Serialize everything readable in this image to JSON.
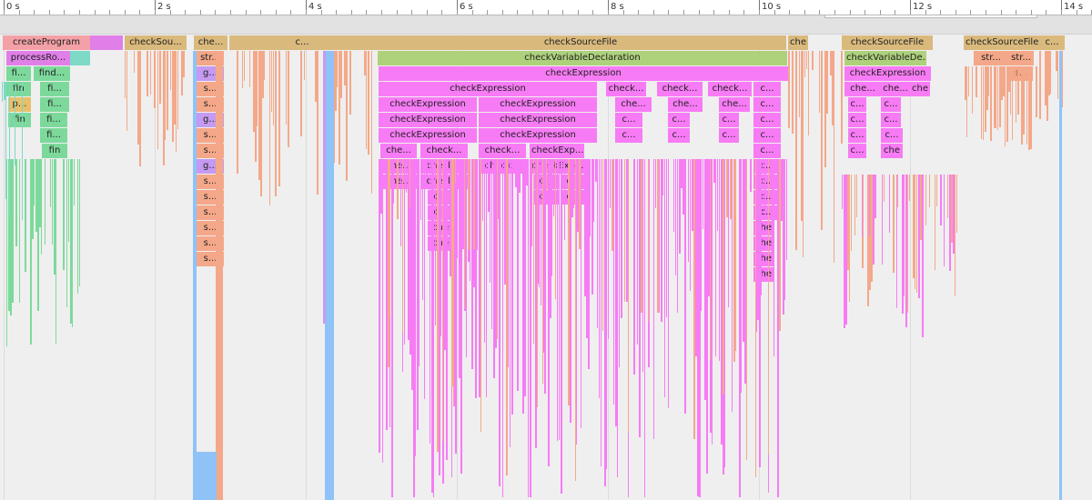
{
  "ruler": {
    "labels": [
      "0 s",
      "2 s",
      "4 s",
      "6 s",
      "8 s",
      "10 s",
      "12 s",
      "14 s"
    ]
  },
  "colors": {
    "program": "#f3a0a6",
    "root": "#e17fe8",
    "host": "#7ed9c7",
    "find": "#7dd99b",
    "check": "#d9b97c",
    "variable": "#aed17c",
    "expression": "#f77bf5",
    "string": "#f4a889",
    "get": "#c59af2",
    "gc": "#8fc3f7",
    "type": "#e8c06c"
  },
  "frames": [
    {
      "label": "createProgram",
      "color": "program"
    },
    {
      "label": "",
      "color": "root"
    },
    {
      "label": "checkSou...",
      "color": "check"
    },
    {
      "label": "che...",
      "color": "check"
    },
    {
      "label": "c...",
      "color": "check"
    },
    {
      "label": "checkSourceFile",
      "color": "check"
    },
    {
      "label": "che",
      "color": "check"
    },
    {
      "label": "checkSourceFile",
      "color": "check"
    },
    {
      "label": "checkSourceFile",
      "color": "check"
    },
    {
      "label": "c...",
      "color": "check"
    },
    {
      "label": "processRo...",
      "color": "root"
    },
    {
      "label": "",
      "color": "host"
    },
    {
      "label": "str...",
      "color": "string"
    },
    {
      "label": "checkVariableDeclaration",
      "color": "variable"
    },
    {
      "label": "checkVariableDe...",
      "color": "variable"
    },
    {
      "label": "str...",
      "color": "string"
    },
    {
      "label": "str...",
      "color": "string"
    },
    {
      "label": "fi...",
      "color": "find"
    },
    {
      "label": "find...",
      "color": "find"
    },
    {
      "label": "g...",
      "color": "get"
    },
    {
      "label": "checkExpression",
      "color": "expression"
    },
    {
      "label": "checkExpression",
      "color": "expression"
    },
    {
      "label": "s...",
      "color": "string"
    },
    {
      "label": "fin",
      "color": "find"
    },
    {
      "label": "fi...",
      "color": "find"
    },
    {
      "label": "s...",
      "color": "string"
    },
    {
      "label": "checkExpression",
      "color": "expression"
    },
    {
      "label": "check...",
      "color": "expression"
    },
    {
      "label": "check...",
      "color": "expression"
    },
    {
      "label": "check...",
      "color": "expression"
    },
    {
      "label": "c...",
      "color": "expression"
    },
    {
      "label": "che...",
      "color": "expression"
    },
    {
      "label": "che...",
      "color": "expression"
    },
    {
      "label": "che",
      "color": "expression"
    },
    {
      "label": "p...",
      "color": "type"
    },
    {
      "label": "fi...",
      "color": "find"
    },
    {
      "label": "s...",
      "color": "string"
    },
    {
      "label": "checkExpression",
      "color": "expression"
    },
    {
      "label": "checkExpression",
      "color": "expression"
    },
    {
      "label": "che...",
      "color": "expression"
    },
    {
      "label": "che...",
      "color": "expression"
    },
    {
      "label": "che...",
      "color": "expression"
    },
    {
      "label": "c...",
      "color": "expression"
    },
    {
      "label": "c...",
      "color": "expression"
    },
    {
      "label": "c...",
      "color": "expression"
    },
    {
      "label": "fin",
      "color": "find"
    },
    {
      "label": "fi...",
      "color": "find"
    },
    {
      "label": "g...",
      "color": "get"
    },
    {
      "label": "checkExpression",
      "color": "expression"
    },
    {
      "label": "checkExpression",
      "color": "expression"
    },
    {
      "label": "c...",
      "color": "expression"
    },
    {
      "label": "c...",
      "color": "expression"
    },
    {
      "label": "c...",
      "color": "expression"
    },
    {
      "label": "c...",
      "color": "expression"
    },
    {
      "label": "c...",
      "color": "expression"
    },
    {
      "label": "c...",
      "color": "expression"
    },
    {
      "label": "fi...",
      "color": "find"
    },
    {
      "label": "s...",
      "color": "string"
    },
    {
      "label": "checkExpression",
      "color": "expression"
    },
    {
      "label": "checkExpression",
      "color": "expression"
    },
    {
      "label": "c...",
      "color": "expression"
    },
    {
      "label": "c...",
      "color": "expression"
    },
    {
      "label": "c...",
      "color": "expression"
    },
    {
      "label": "c...",
      "color": "expression"
    },
    {
      "label": "c...",
      "color": "expression"
    },
    {
      "label": "c...",
      "color": "expression"
    },
    {
      "label": "fin",
      "color": "find"
    },
    {
      "label": "s...",
      "color": "string"
    },
    {
      "label": "che...",
      "color": "expression"
    },
    {
      "label": "check...",
      "color": "expression"
    },
    {
      "label": "check...",
      "color": "expression"
    },
    {
      "label": "checkExp...",
      "color": "expression"
    },
    {
      "label": "c...",
      "color": "expression"
    },
    {
      "label": "c...",
      "color": "expression"
    },
    {
      "label": "che",
      "color": "expression"
    },
    {
      "label": "g...",
      "color": "get"
    },
    {
      "label": "che...",
      "color": "expression"
    },
    {
      "label": "check...",
      "color": "expression"
    },
    {
      "label": "check...",
      "color": "expression"
    },
    {
      "label": "checkExp...",
      "color": "expression"
    },
    {
      "label": "c...",
      "color": "expression"
    },
    {
      "label": "s...",
      "color": "string"
    },
    {
      "label": "che...",
      "color": "expression"
    },
    {
      "label": "check...",
      "color": "expression"
    },
    {
      "label": "c...",
      "color": "expression"
    },
    {
      "label": "c...",
      "color": "expression"
    },
    {
      "label": "c...",
      "color": "expression"
    },
    {
      "label": "s...",
      "color": "string"
    },
    {
      "label": "c...",
      "color": "expression"
    },
    {
      "label": "c...",
      "color": "expression"
    },
    {
      "label": "c...",
      "color": "expression"
    },
    {
      "label": "c...",
      "color": "expression"
    },
    {
      "label": "s...",
      "color": "string"
    },
    {
      "label": "c...",
      "color": "expression"
    },
    {
      "label": "c...",
      "color": "expression"
    },
    {
      "label": "s...",
      "color": "string"
    },
    {
      "label": "che",
      "color": "expression"
    },
    {
      "label": "che",
      "color": "expression"
    },
    {
      "label": "s...",
      "color": "string"
    },
    {
      "label": "che",
      "color": "expression"
    },
    {
      "label": "che",
      "color": "expression"
    },
    {
      "label": "s...",
      "color": "string"
    },
    {
      "label": "che",
      "color": "expression"
    },
    {
      "label": "che",
      "color": "expression"
    }
  ]
}
